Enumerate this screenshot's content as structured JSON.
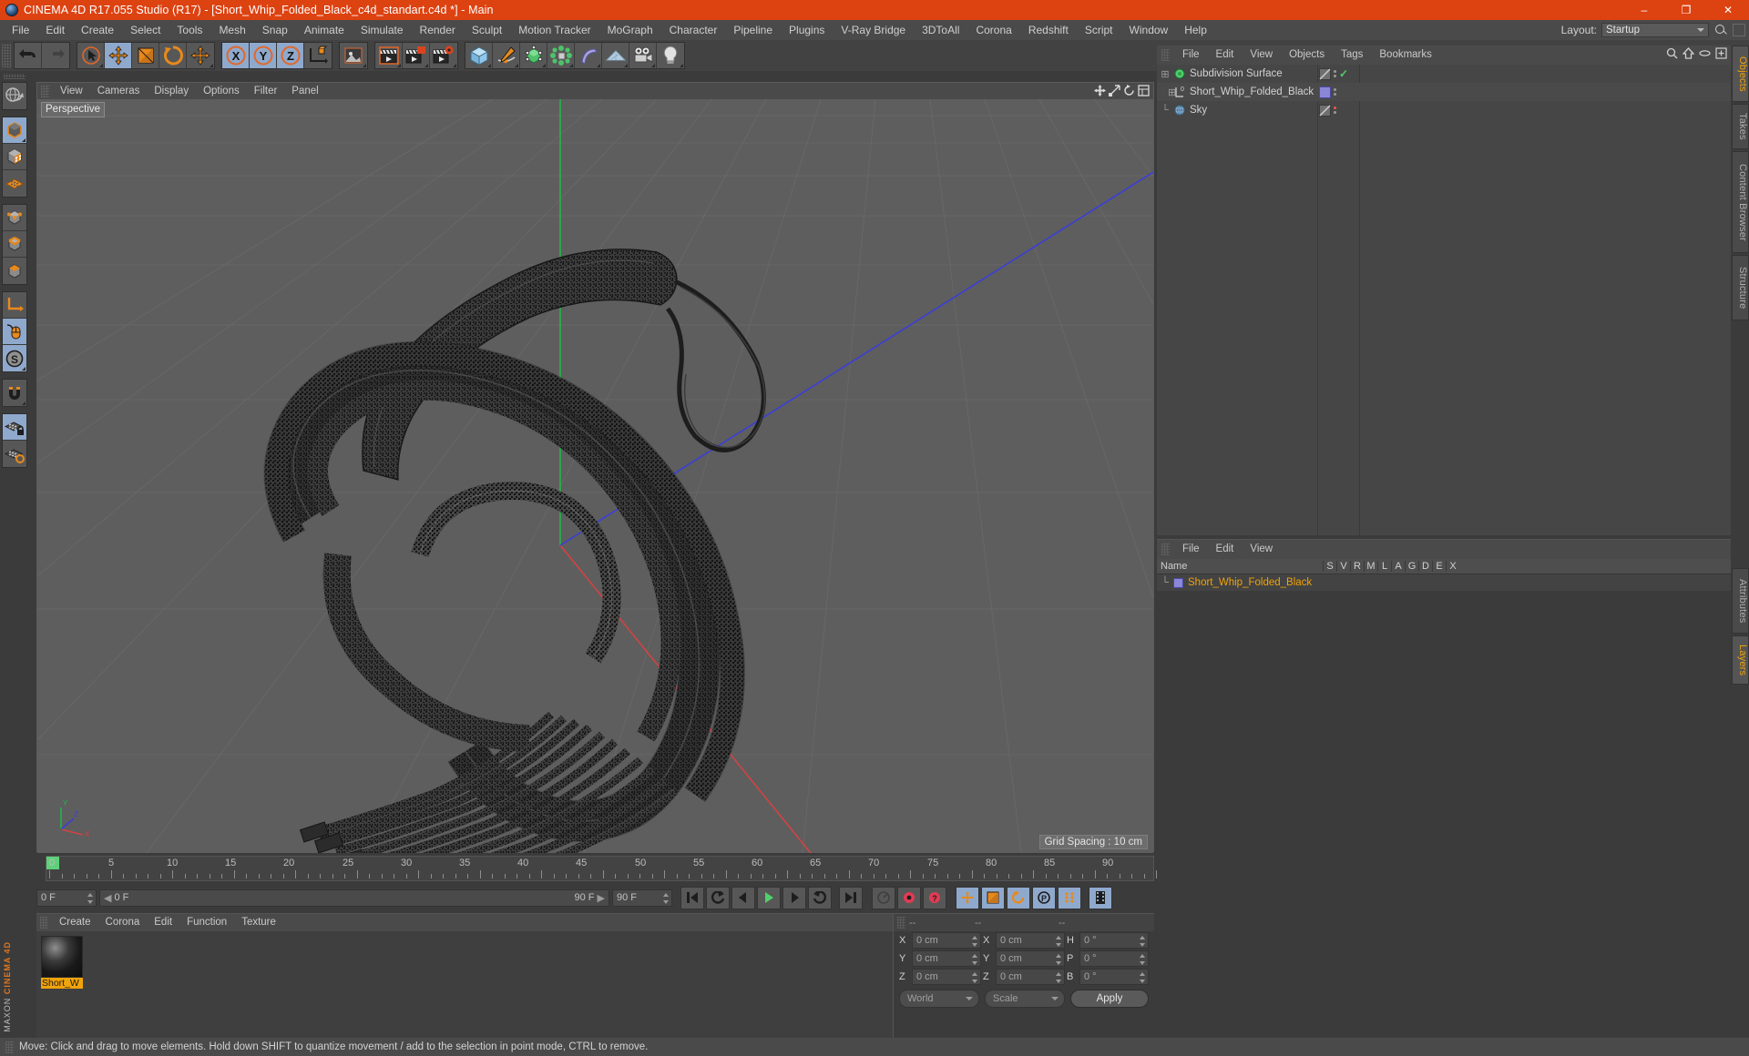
{
  "titlebar": {
    "title": "CINEMA 4D R17.055 Studio (R17) - [Short_Whip_Folded_Black_c4d_standart.c4d *] - Main",
    "logo_icon": "c4d-logo-icon",
    "minimize": "–",
    "maximize": "❐",
    "close": "✕",
    "accent_color": "#dd4211"
  },
  "menubar": {
    "items": [
      {
        "label": "File"
      },
      {
        "label": "Edit"
      },
      {
        "label": "Create"
      },
      {
        "label": "Select"
      },
      {
        "label": "Tools"
      },
      {
        "label": "Mesh"
      },
      {
        "label": "Snap"
      },
      {
        "label": "Animate"
      },
      {
        "label": "Simulate"
      },
      {
        "label": "Render"
      },
      {
        "label": "Sculpt"
      },
      {
        "label": "Motion Tracker"
      },
      {
        "label": "MoGraph"
      },
      {
        "label": "Character"
      },
      {
        "label": "Pipeline"
      },
      {
        "label": "Plugins"
      },
      {
        "label": "V-Ray Bridge"
      },
      {
        "label": "3DToAll"
      },
      {
        "label": "Corona"
      },
      {
        "label": "Redshift"
      },
      {
        "label": "Script"
      },
      {
        "label": "Window"
      },
      {
        "label": "Help"
      }
    ],
    "layout_label": "Layout:",
    "layout_value": "Startup",
    "search_icon": "search-icon"
  },
  "toolbar": {
    "groups": [
      {
        "name": "undo-redo",
        "buttons": [
          {
            "name": "undo-button",
            "icon": "undo-icon",
            "active": false
          },
          {
            "name": "redo-button",
            "icon": "redo-icon",
            "active": false
          }
        ]
      },
      {
        "name": "transform-tools",
        "buttons": [
          {
            "name": "live-selection-button",
            "icon": "cursor-select-icon",
            "active": false
          },
          {
            "name": "move-tool-button",
            "icon": "move-icon",
            "active": true
          },
          {
            "name": "scale-tool-button",
            "icon": "scale-icon",
            "active": false
          },
          {
            "name": "rotate-tool-button",
            "icon": "rotate-icon",
            "active": false
          },
          {
            "name": "free-move-button",
            "icon": "move-icon",
            "active": false
          }
        ]
      },
      {
        "name": "axis-locks",
        "buttons": [
          {
            "name": "x-axis-button",
            "icon": "axis-x-icon",
            "active": true,
            "letter": "X"
          },
          {
            "name": "y-axis-button",
            "icon": "axis-y-icon",
            "active": true,
            "letter": "Y"
          },
          {
            "name": "z-axis-button",
            "icon": "axis-z-icon",
            "active": true,
            "letter": "Z"
          },
          {
            "name": "world-object-button",
            "icon": "world-axis-icon",
            "active": false
          }
        ]
      },
      {
        "name": "render-group-a",
        "buttons": [
          {
            "name": "render-preview-button",
            "icon": "render-region-icon",
            "active": false
          }
        ]
      },
      {
        "name": "render-group",
        "buttons": [
          {
            "name": "render-view-button",
            "icon": "clapper-icon",
            "active": false
          },
          {
            "name": "render-to-picture-viewer-button",
            "icon": "clapper-picture-icon",
            "active": false
          },
          {
            "name": "render-settings-button",
            "icon": "clapper-gear-icon",
            "active": false
          }
        ]
      },
      {
        "name": "create-objects",
        "buttons": [
          {
            "name": "add-cube-button",
            "icon": "cube-icon",
            "active": false
          },
          {
            "name": "add-spline-button",
            "icon": "pen-spline-icon",
            "active": false
          },
          {
            "name": "nurbs-button",
            "icon": "subdivision-cube-icon",
            "active": false
          },
          {
            "name": "array-button",
            "icon": "mograph-cluster-icon",
            "active": false
          },
          {
            "name": "deformer-button",
            "icon": "bend-deformer-icon",
            "active": false
          },
          {
            "name": "environment-button",
            "icon": "floor-grid-icon",
            "active": false
          },
          {
            "name": "camera-button",
            "icon": "camera-icon",
            "active": false
          },
          {
            "name": "light-button",
            "icon": "light-bulb-icon",
            "active": false
          }
        ]
      }
    ]
  },
  "left_toolbar": {
    "groups": [
      {
        "buttons": [
          {
            "name": "undo-view-button",
            "icon": "globe-sphere-icon",
            "active": false
          }
        ]
      },
      {
        "buttons": [
          {
            "name": "editable-object-button",
            "icon": "make-editable-icon",
            "active": true
          },
          {
            "name": "model-mode-button",
            "icon": "checker-cube-icon",
            "active": false
          },
          {
            "name": "texture-mode-button",
            "icon": "texture-grid-icon",
            "active": false
          }
        ]
      },
      {
        "buttons": [
          {
            "name": "points-mode-button",
            "icon": "points-cube-icon",
            "active": false
          },
          {
            "name": "edges-mode-button",
            "icon": "edges-cube-icon",
            "active": false
          },
          {
            "name": "polygons-mode-button",
            "icon": "polygon-cube-icon",
            "active": false
          }
        ]
      },
      {
        "buttons": [
          {
            "name": "axis-modify-button",
            "icon": "axis-l-icon",
            "active": false
          },
          {
            "name": "enable-snapping-button",
            "icon": "mouse-icon",
            "active": true
          },
          {
            "name": "workplane-button",
            "icon": "s-circle-icon",
            "active": true
          }
        ]
      },
      {
        "buttons": [
          {
            "name": "magnet-button",
            "icon": "magnet-icon",
            "active": false
          }
        ]
      },
      {
        "buttons": [
          {
            "name": "lock-grid-button",
            "icon": "grid-lock-icon",
            "active": true
          },
          {
            "name": "workplane-lock-button",
            "icon": "grid-workplane-icon",
            "active": true
          }
        ]
      }
    ],
    "brand_line1": "MAXON",
    "brand_line2": "CINEMA 4D"
  },
  "viewport": {
    "menu": [
      {
        "label": "View"
      },
      {
        "label": "Cameras"
      },
      {
        "label": "Display"
      },
      {
        "label": "Options"
      },
      {
        "label": "Filter"
      },
      {
        "label": "Panel"
      }
    ],
    "corner_icons": [
      "move-view-icon",
      "scale-view-icon",
      "rotate-view-icon",
      "maximize-view-icon"
    ],
    "perspective_label": "Perspective",
    "grid_spacing": "Grid Spacing : 10 cm",
    "axis_labels": {
      "x": "X",
      "y": "Y",
      "z": "Z"
    },
    "background_color": "#5e5e5e",
    "object_color": "#3a3a3a"
  },
  "timeline": {
    "ticks": [
      {
        "value": "0",
        "pos": 0
      },
      {
        "value": "5",
        "pos": 5
      },
      {
        "value": "10",
        "pos": 10
      },
      {
        "value": "15",
        "pos": 15
      },
      {
        "value": "20",
        "pos": 20
      },
      {
        "value": "25",
        "pos": 25
      },
      {
        "value": "30",
        "pos": 30
      },
      {
        "value": "35",
        "pos": 35
      },
      {
        "value": "40",
        "pos": 40
      },
      {
        "value": "45",
        "pos": 45
      },
      {
        "value": "50",
        "pos": 50
      },
      {
        "value": "55",
        "pos": 55
      },
      {
        "value": "60",
        "pos": 60
      },
      {
        "value": "65",
        "pos": 65
      },
      {
        "value": "70",
        "pos": 70
      },
      {
        "value": "75",
        "pos": 75
      },
      {
        "value": "80",
        "pos": 80
      },
      {
        "value": "85",
        "pos": 85
      },
      {
        "value": "90",
        "pos": 90
      }
    ],
    "range_start": 0,
    "range_end": 90,
    "current_frame_field": "0 F",
    "start_field": "0 F",
    "end_field": "90 F",
    "preview_end_field": "90 F",
    "right_frame_field": "0 F",
    "transport": [
      {
        "name": "go-to-start-button",
        "icon": "skip-start-icon",
        "active": false
      },
      {
        "name": "play-previous-key-button",
        "icon": "prev-key-icon",
        "active": false
      },
      {
        "name": "step-back-button",
        "icon": "step-back-icon",
        "active": false
      },
      {
        "name": "play-button",
        "icon": "play-icon",
        "active": false
      },
      {
        "name": "step-forward-button",
        "icon": "step-forward-icon",
        "active": false
      },
      {
        "name": "play-next-key-button",
        "icon": "next-key-icon",
        "active": false
      },
      {
        "name": "go-to-end-button",
        "icon": "skip-end-icon",
        "active": false
      }
    ],
    "record_group": [
      {
        "name": "autokey-button",
        "icon": "gauge-icon",
        "active": false
      },
      {
        "name": "record-active-objects-button",
        "icon": "record-red-icon",
        "active": false
      },
      {
        "name": "autokeying-button",
        "icon": "autokey-red-icon",
        "active": false
      }
    ],
    "key_group": [
      {
        "name": "key-position-button",
        "icon": "key-position-icon",
        "active": true
      },
      {
        "name": "key-scale-button",
        "icon": "key-scale-icon",
        "active": true
      },
      {
        "name": "key-rotation-button",
        "icon": "key-rotation-icon",
        "active": true
      },
      {
        "name": "key-parameter-button",
        "icon": "key-param-icon",
        "active": true
      },
      {
        "name": "key-pla-button",
        "icon": "key-pla-icon",
        "active": true
      },
      {
        "name": "timeline-strip-button",
        "icon": "film-strip-icon",
        "active": true
      }
    ]
  },
  "material_manager": {
    "menu": [
      {
        "label": "Create"
      },
      {
        "label": "Corona"
      },
      {
        "label": "Edit"
      },
      {
        "label": "Function"
      },
      {
        "label": "Texture"
      }
    ],
    "materials": [
      {
        "name": "Short_W",
        "preview": "black-glossy-sphere",
        "selected": true
      }
    ]
  },
  "coordinates": {
    "headers": [
      "--",
      "--",
      "--"
    ],
    "rows": [
      {
        "label1": "X",
        "value1": "0 cm",
        "label2": "X",
        "value2": "0 cm",
        "label3": "H",
        "value3": "0 °"
      },
      {
        "label1": "Y",
        "value1": "0 cm",
        "label2": "Y",
        "value2": "0 cm",
        "label3": "P",
        "value3": "0 °"
      },
      {
        "label1": "Z",
        "value1": "0 cm",
        "label2": "Z",
        "value2": "0 cm",
        "label3": "B",
        "value3": "0 °"
      }
    ],
    "system_select": "World",
    "mode_select": "Scale",
    "apply_label": "Apply"
  },
  "object_manager": {
    "menu": [
      {
        "label": "File"
      },
      {
        "label": "Edit"
      },
      {
        "label": "View"
      },
      {
        "label": "Objects"
      },
      {
        "label": "Tags"
      },
      {
        "label": "Bookmarks"
      }
    ],
    "header_icons": [
      "search-icon",
      "home-icon",
      "eye-icon",
      "expand-icon"
    ],
    "objects": [
      {
        "name": "Subdivision Surface",
        "icon": "subdivision-surface-icon",
        "indent": 0,
        "selected": false,
        "expandable": true,
        "tag": "display-tag",
        "dot_color": "#6ed16e",
        "check": true
      },
      {
        "name": "Short_Whip_Folded_Black",
        "icon": "polygon-object-icon",
        "indent": 1,
        "selected": false,
        "expandable": true,
        "tag": "material-tag",
        "dot_color": "#8a86d8",
        "check": false
      },
      {
        "name": "Sky",
        "icon": "sky-object-icon",
        "indent": 0,
        "selected": false,
        "expandable": false,
        "tag": "display-tag",
        "dot_color": "#ef5350",
        "check": false
      }
    ]
  },
  "layer_manager": {
    "menu": [
      {
        "label": "File"
      },
      {
        "label": "Edit"
      },
      {
        "label": "View"
      }
    ],
    "columns": [
      "Name",
      "S",
      "V",
      "R",
      "M",
      "L",
      "A",
      "G",
      "D",
      "E",
      "X"
    ],
    "rows": [
      {
        "name": "Short_Whip_Folded_Black",
        "color": "#8a86d8",
        "selected": true
      }
    ]
  },
  "vertical_tabs_right": [
    {
      "label": "Objects",
      "active": true
    },
    {
      "label": "Takes",
      "active": false
    },
    {
      "label": "Content Browser",
      "active": false
    },
    {
      "label": "Structure",
      "active": false
    }
  ],
  "vertical_tabs_bottom": [
    {
      "label": "Attributes",
      "active": false
    },
    {
      "label": "Layers",
      "active": true
    }
  ],
  "statusbar": {
    "message": "Move: Click and drag to move elements. Hold down SHIFT to quantize movement / add to the selection in point mode, CTRL to remove."
  }
}
